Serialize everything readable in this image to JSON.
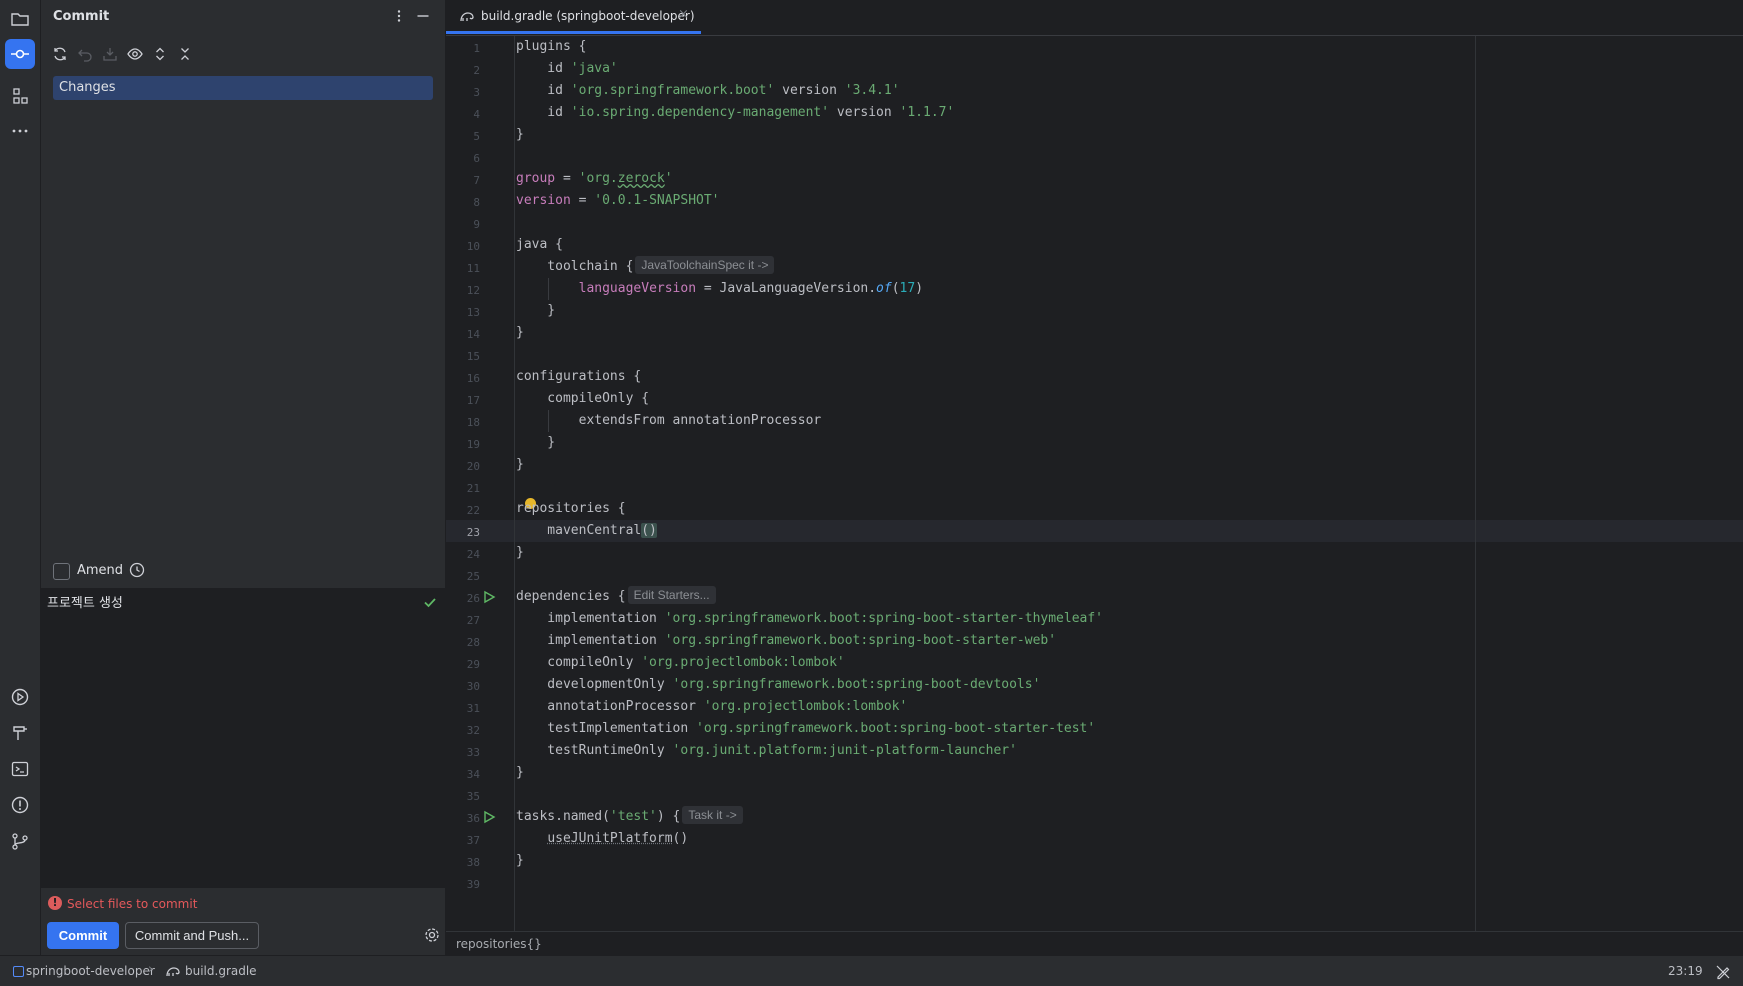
{
  "commit_panel": {
    "title": "Commit",
    "changes_label": "Changes",
    "amend_label": "Amend",
    "commit_message": "프로젝트 생성",
    "warning": "Select files to commit",
    "commit_button": "Commit",
    "commit_push_button": "Commit and Push..."
  },
  "editor": {
    "tab_label": "build.gradle (springboot-developer)",
    "tab_close": "×",
    "breadcrumb": "repositories{}",
    "current_line": 23,
    "line_numbers": [
      "1",
      "2",
      "3",
      "4",
      "5",
      "6",
      "7",
      "8",
      "9",
      "10",
      "11",
      "12",
      "13",
      "14",
      "15",
      "16",
      "17",
      "18",
      "19",
      "20",
      "21",
      "22",
      "23",
      "24",
      "25",
      "26",
      "27",
      "28",
      "29",
      "30",
      "31",
      "32",
      "33",
      "34",
      "35",
      "36",
      "37",
      "38",
      "39"
    ],
    "code": {
      "l1": "plugins {",
      "l2_kw": "    id ",
      "l2_str": "'java'",
      "l3_kw": "    id ",
      "l3_str": "'org.springframework.boot'",
      "l3_mid": " version ",
      "l3_ver": "'3.4.1'",
      "l4_kw": "    id ",
      "l4_str": "'io.spring.dependency-management'",
      "l4_mid": " version ",
      "l4_ver": "'1.1.7'",
      "l5": "}",
      "l7_var": "group",
      "l7_eq": " = ",
      "l7_q1": "'org.",
      "l7_wavy": "zerock",
      "l7_q2": "'",
      "l8_var": "version",
      "l8_eq": " = ",
      "l8_str": "'0.0.1-SNAPSHOT'",
      "l10": "java {",
      "l11": "    toolchain {",
      "l11_hint": "JavaToolchainSpec it ->",
      "l12_prop": "languageVersion",
      "l12_mid": " = JavaLanguageVersion.",
      "l12_fn": "of",
      "l12_open": "(",
      "l12_num": "17",
      "l12_close": ")",
      "l13": "    }",
      "l14": "}",
      "l16": "configurations {",
      "l17": "    compileOnly {",
      "l18": "        extendsFrom annotationProcessor",
      "l19": "    }",
      "l20": "}",
      "l22": "repositories {",
      "l23_a": "    mavenCentral",
      "l23_b": "()",
      "l24": "}",
      "l26": "dependencies {",
      "l26_hint": "Edit Starters...",
      "l27_kw": "    implementation ",
      "l27_str": "'org.springframework.boot:spring-boot-starter-thymeleaf'",
      "l28_kw": "    implementation ",
      "l28_str": "'org.springframework.boot:spring-boot-starter-web'",
      "l29_kw": "    compileOnly ",
      "l29_str": "'org.projectlombok:lombok'",
      "l30_kw": "    developmentOnly ",
      "l30_str": "'org.springframework.boot:spring-boot-devtools'",
      "l31_kw": "    annotationProcessor ",
      "l31_str": "'org.projectlombok:lombok'",
      "l32_kw": "    testImplementation ",
      "l32_str": "'org.springframework.boot:spring-boot-starter-test'",
      "l33_kw": "    testRuntimeOnly ",
      "l33_str": "'org.junit.platform:junit-platform-launcher'",
      "l34": "}",
      "l36_a": "tasks.named(",
      "l36_str": "'test'",
      "l36_b": ") {",
      "l36_hint": "Task it ->",
      "l37_fn": "useJUnitPlatform",
      "l37_b": "()",
      "l38": "}"
    }
  },
  "statusbar": {
    "project": "springboot-developer",
    "separator": "›",
    "file": "build.gradle",
    "position": "23:19"
  },
  "colors": {
    "accent": "#3574f0",
    "string": "#6aab73",
    "number": "#2aacb8",
    "field": "#c77dbb",
    "error": "#db5c5c"
  },
  "icons": [
    "folder-icon",
    "commit-icon",
    "structure-icon",
    "more-icon",
    "run-icon",
    "build-icon",
    "terminal-icon",
    "problems-icon",
    "git-branch-icon",
    "refresh-icon",
    "rollback-icon",
    "shelve-icon",
    "eye-icon",
    "expand-icon",
    "collapse-icon",
    "history-icon",
    "check-icon",
    "gear-icon",
    "gradle-icon",
    "readonly-icon"
  ]
}
